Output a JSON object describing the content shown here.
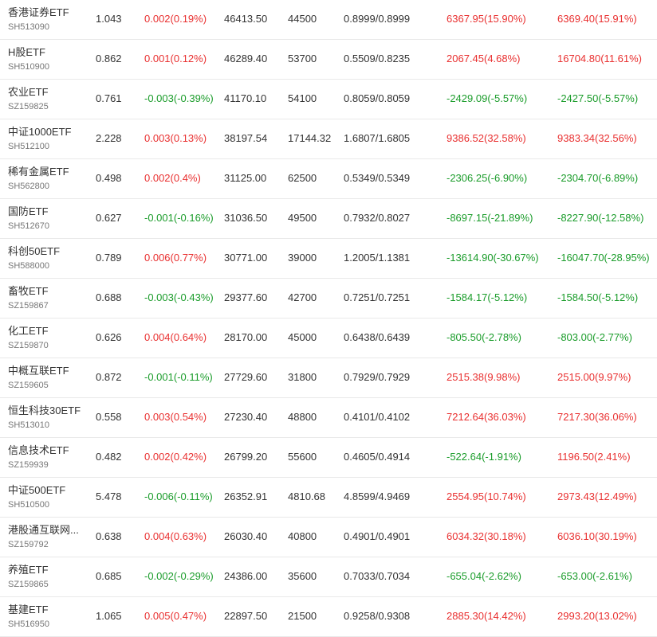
{
  "colors": {
    "up": "#e93030",
    "down": "#1a9c2a",
    "text": "#333333",
    "subtext": "#777777",
    "divider": "#e9e9e9"
  },
  "rows": [
    {
      "name": "香港证券ETF",
      "code": "SH513090",
      "price": "1.043",
      "change": "0.002(0.19%)",
      "change_dir": "up",
      "amount": "46413.50",
      "volume": "44500",
      "range": "0.8999/0.8999",
      "pl1": "6367.95(15.90%)",
      "pl1_dir": "up",
      "pl2": "6369.40(15.91%)",
      "pl2_dir": "up"
    },
    {
      "name": "H股ETF",
      "code": "SH510900",
      "price": "0.862",
      "change": "0.001(0.12%)",
      "change_dir": "up",
      "amount": "46289.40",
      "volume": "53700",
      "range": "0.5509/0.8235",
      "pl1": "2067.45(4.68%)",
      "pl1_dir": "up",
      "pl2": "16704.80(11.61%)",
      "pl2_dir": "up"
    },
    {
      "name": "农业ETF",
      "code": "SZ159825",
      "price": "0.761",
      "change": "-0.003(-0.39%)",
      "change_dir": "down",
      "amount": "41170.10",
      "volume": "54100",
      "range": "0.8059/0.8059",
      "pl1": "-2429.09(-5.57%)",
      "pl1_dir": "down",
      "pl2": "-2427.50(-5.57%)",
      "pl2_dir": "down"
    },
    {
      "name": "中证1000ETF",
      "code": "SH512100",
      "price": "2.228",
      "change": "0.003(0.13%)",
      "change_dir": "up",
      "amount": "38197.54",
      "volume": "17144.32",
      "range": "1.6807/1.6805",
      "pl1": "9386.52(32.58%)",
      "pl1_dir": "up",
      "pl2": "9383.34(32.56%)",
      "pl2_dir": "up"
    },
    {
      "name": "稀有金属ETF",
      "code": "SH562800",
      "price": "0.498",
      "change": "0.002(0.4%)",
      "change_dir": "up",
      "amount": "31125.00",
      "volume": "62500",
      "range": "0.5349/0.5349",
      "pl1": "-2306.25(-6.90%)",
      "pl1_dir": "down",
      "pl2": "-2304.70(-6.89%)",
      "pl2_dir": "down"
    },
    {
      "name": "国防ETF",
      "code": "SH512670",
      "price": "0.627",
      "change": "-0.001(-0.16%)",
      "change_dir": "down",
      "amount": "31036.50",
      "volume": "49500",
      "range": "0.7932/0.8027",
      "pl1": "-8697.15(-21.89%)",
      "pl1_dir": "down",
      "pl2": "-8227.90(-12.58%)",
      "pl2_dir": "down"
    },
    {
      "name": "科创50ETF",
      "code": "SH588000",
      "price": "0.789",
      "change": "0.006(0.77%)",
      "change_dir": "up",
      "amount": "30771.00",
      "volume": "39000",
      "range": "1.2005/1.1381",
      "pl1": "-13614.90(-30.67%)",
      "pl1_dir": "down",
      "pl2": "-16047.70(-28.95%)",
      "pl2_dir": "down"
    },
    {
      "name": "畜牧ETF",
      "code": "SZ159867",
      "price": "0.688",
      "change": "-0.003(-0.43%)",
      "change_dir": "down",
      "amount": "29377.60",
      "volume": "42700",
      "range": "0.7251/0.7251",
      "pl1": "-1584.17(-5.12%)",
      "pl1_dir": "down",
      "pl2": "-1584.50(-5.12%)",
      "pl2_dir": "down"
    },
    {
      "name": "化工ETF",
      "code": "SZ159870",
      "price": "0.626",
      "change": "0.004(0.64%)",
      "change_dir": "up",
      "amount": "28170.00",
      "volume": "45000",
      "range": "0.6438/0.6439",
      "pl1": "-805.50(-2.78%)",
      "pl1_dir": "down",
      "pl2": "-803.00(-2.77%)",
      "pl2_dir": "down"
    },
    {
      "name": "中概互联ETF",
      "code": "SZ159605",
      "price": "0.872",
      "change": "-0.001(-0.11%)",
      "change_dir": "down",
      "amount": "27729.60",
      "volume": "31800",
      "range": "0.7929/0.7929",
      "pl1": "2515.38(9.98%)",
      "pl1_dir": "up",
      "pl2": "2515.00(9.97%)",
      "pl2_dir": "up"
    },
    {
      "name": "恒生科技30ETF",
      "code": "SH513010",
      "price": "0.558",
      "change": "0.003(0.54%)",
      "change_dir": "up",
      "amount": "27230.40",
      "volume": "48800",
      "range": "0.4101/0.4102",
      "pl1": "7212.64(36.03%)",
      "pl1_dir": "up",
      "pl2": "7217.30(36.06%)",
      "pl2_dir": "up"
    },
    {
      "name": "信息技术ETF",
      "code": "SZ159939",
      "price": "0.482",
      "change": "0.002(0.42%)",
      "change_dir": "up",
      "amount": "26799.20",
      "volume": "55600",
      "range": "0.4605/0.4914",
      "pl1": "-522.64(-1.91%)",
      "pl1_dir": "down",
      "pl2": "1196.50(2.41%)",
      "pl2_dir": "up"
    },
    {
      "name": "中证500ETF",
      "code": "SH510500",
      "price": "5.478",
      "change": "-0.006(-0.11%)",
      "change_dir": "down",
      "amount": "26352.91",
      "volume": "4810.68",
      "range": "4.8599/4.9469",
      "pl1": "2554.95(10.74%)",
      "pl1_dir": "up",
      "pl2": "2973.43(12.49%)",
      "pl2_dir": "up"
    },
    {
      "name": "港股通互联网...",
      "code": "SZ159792",
      "price": "0.638",
      "change": "0.004(0.63%)",
      "change_dir": "up",
      "amount": "26030.40",
      "volume": "40800",
      "range": "0.4901/0.4901",
      "pl1": "6034.32(30.18%)",
      "pl1_dir": "up",
      "pl2": "6036.10(30.19%)",
      "pl2_dir": "up"
    },
    {
      "name": "养殖ETF",
      "code": "SZ159865",
      "price": "0.685",
      "change": "-0.002(-0.29%)",
      "change_dir": "down",
      "amount": "24386.00",
      "volume": "35600",
      "range": "0.7033/0.7034",
      "pl1": "-655.04(-2.62%)",
      "pl1_dir": "down",
      "pl2": "-653.00(-2.61%)",
      "pl2_dir": "down"
    },
    {
      "name": "基建ETF",
      "code": "SH516950",
      "price": "1.065",
      "change": "0.005(0.47%)",
      "change_dir": "up",
      "amount": "22897.50",
      "volume": "21500",
      "range": "0.9258/0.9308",
      "pl1": "2885.30(14.42%)",
      "pl1_dir": "up",
      "pl2": "2993.20(13.02%)",
      "pl2_dir": "up"
    }
  ]
}
